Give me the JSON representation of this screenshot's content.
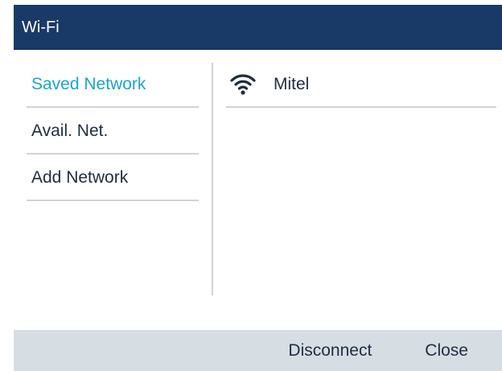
{
  "window": {
    "title": "Wi-Fi"
  },
  "left_nav": {
    "items": [
      {
        "label": "Saved Network",
        "active": true
      },
      {
        "label": "Avail. Net.",
        "active": false
      },
      {
        "label": "Add Network",
        "active": false
      }
    ]
  },
  "networks": [
    {
      "name": "Mitel",
      "icon": "wifi-icon"
    }
  ],
  "softkeys": {
    "disconnect_label": "Disconnect",
    "close_label": "Close"
  },
  "colors": {
    "titlebar": "#193a66",
    "active_text": "#1aa4d8",
    "text": "#1f2c44",
    "divider": "#cfd3d7",
    "softkey_bar": "#d7dee3"
  }
}
